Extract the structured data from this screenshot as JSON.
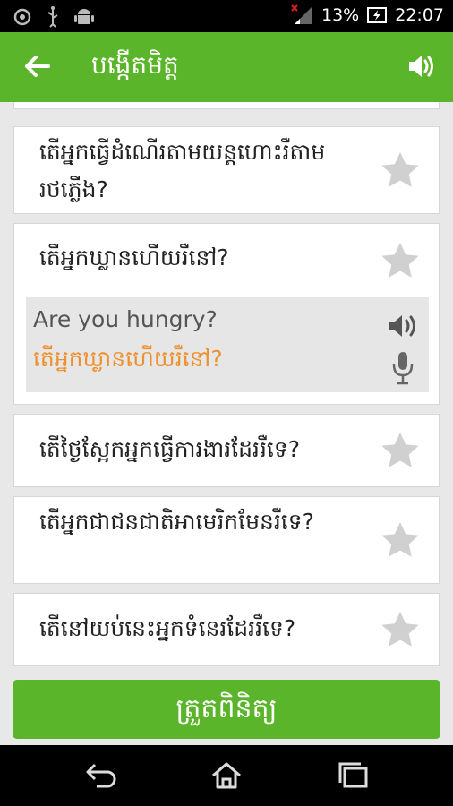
{
  "status_bar": {
    "battery_percent": "13%",
    "time": "22:07"
  },
  "app_bar": {
    "title": "បង្កើតមិត្ត"
  },
  "phrases": [
    {
      "text": "តើអ្នកធ្វើដំណើរតាមយន្តហោះរឺតាមរថភ្លើង?"
    },
    {
      "text": "តើអ្នកឃ្លានហើយរឺនៅ?",
      "translation": "Are you hungry?",
      "recorded": "តើអ្នកឃ្លានហើយរឺនៅ?"
    },
    {
      "text": "តើថ្ងៃស្អែកអ្នកធ្វើការងារដែររឺទេ?"
    },
    {
      "text": "តើអ្នកជាជនជាតិអាមេរិកមែនរឺទេ?"
    },
    {
      "text": "តើនៅយប់នេះអ្នកទំនេរដែររឺទេ?"
    }
  ],
  "review_button": {
    "label": "ត្រួតពិនិត្យ"
  },
  "colors": {
    "accent": "#5bb52a",
    "recognized_text": "#f0902c",
    "star_inactive": "#d0d0d0"
  },
  "icons": [
    "back-arrow-icon",
    "speaker-icon",
    "star-icon",
    "microphone-icon",
    "nav-back-icon",
    "nav-home-icon",
    "nav-recent-icon"
  ]
}
